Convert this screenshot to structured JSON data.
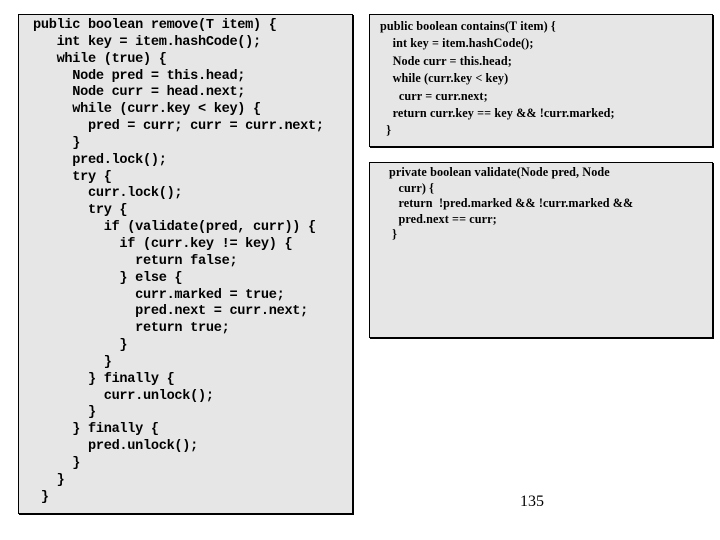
{
  "slide": {
    "page_number": "135"
  },
  "remove_method": {
    "lines": [
      "public boolean remove(T item) {",
      "   int key = item.hashCode();",
      "   while (true) {",
      "     Node pred = this.head;",
      "     Node curr = head.next;",
      "     while (curr.key < key) {",
      "       pred = curr; curr = curr.next;",
      "     }",
      "     pred.lock();",
      "     try {",
      "       curr.lock();",
      "       try {",
      "         if (validate(pred, curr)) {",
      "           if (curr.key != key) {",
      "             return false;",
      "           } else {",
      "             curr.marked = true;",
      "             pred.next = curr.next;",
      "             return true;",
      "           }",
      "         }",
      "       } finally {",
      "         curr.unlock();",
      "       }",
      "     } finally {",
      "       pred.unlock();",
      "     }",
      "   }",
      " }"
    ]
  },
  "contains_method": {
    "lines": [
      "public boolean contains(T item) {",
      "    int key = item.hashCode();",
      "    Node curr = this.head;",
      "    while (curr.key < key)",
      "      curr = curr.next;",
      "    return curr.key == key && !curr.marked;",
      "  }"
    ]
  },
  "validate_method": {
    "lines": [
      "private boolean validate(Node pred, Node",
      "   curr) {",
      "   return  !pred.marked && !curr.marked &&",
      "   pred.next == curr;",
      " }"
    ]
  }
}
